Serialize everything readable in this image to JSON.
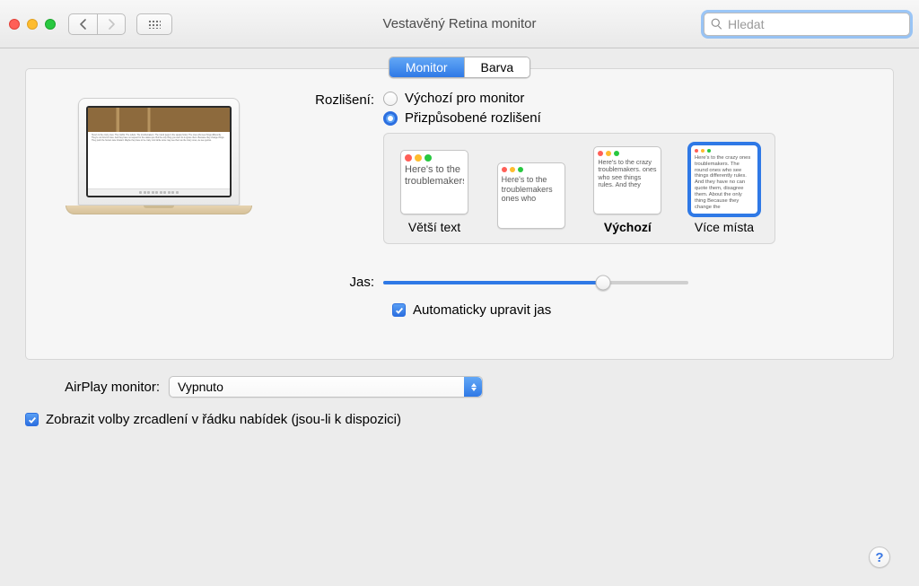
{
  "titlebar": {
    "title": "Vestavěný Retina monitor",
    "search_placeholder": "Hledat"
  },
  "tabs": {
    "monitor": "Monitor",
    "color": "Barva",
    "active": "monitor"
  },
  "resolution": {
    "label": "Rozlišení:",
    "default_label": "Výchozí pro monitor",
    "scaled_label": "Přizpůsobené rozlišení",
    "selected": "scaled",
    "previews": [
      {
        "label": "Větší text",
        "sample": "Here's to the troublemakers",
        "selected": false
      },
      {
        "label": "",
        "sample": "Here's to the troublemakers ones who",
        "selected": false
      },
      {
        "label": "Výchozí",
        "sample": "Here's to the crazy troublemakers. ones who see things rules. And they",
        "selected": true,
        "bold": true
      },
      {
        "label": "Více místa",
        "sample": "Here's to the crazy ones troublemakers. The round ones who see things differently rules. And they have no can quote them, disagree them. About the only thing Because they change the",
        "selected": false
      }
    ]
  },
  "brightness": {
    "label": "Jas:",
    "auto_label": "Automaticky upravit jas",
    "auto_checked": true,
    "value_pct": 72
  },
  "airplay": {
    "label": "AirPlay monitor:",
    "value": "Vypnuto"
  },
  "mirror": {
    "label": "Zobrazit volby zrcadlení v řádku nabídek (jsou-li k dispozici)",
    "checked": true
  },
  "help": "?"
}
